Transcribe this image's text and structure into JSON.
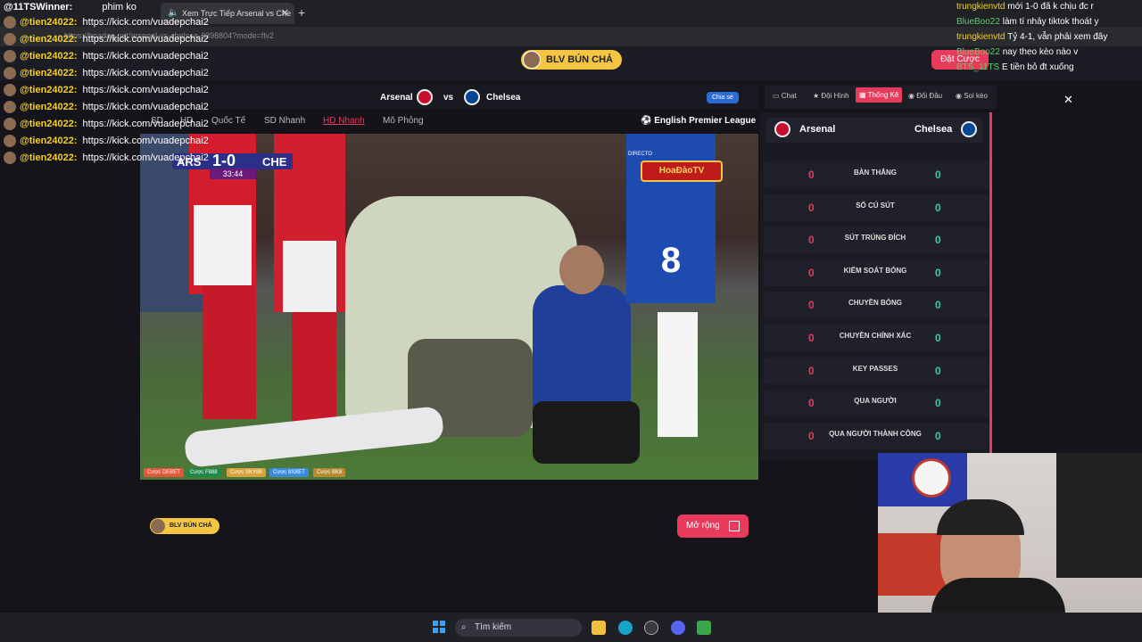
{
  "browser": {
    "tab_title": "Xem Trực Tiếp Arsenal vs Che",
    "url": "https://hoadao.net/arsenal-vs-chelsea-2398804?mode=flv2",
    "overlay_user": "@11TSWinner:",
    "overlay_msg": "phim ko"
  },
  "header": {
    "commentator": "BLV BÚN CHẢ",
    "bet_button": "Đặt Cược"
  },
  "match": {
    "home": "Arsenal",
    "vs": "vs",
    "away": "Chelsea",
    "share": "Chia sẻ",
    "quality_tabs": [
      "SD",
      "HD",
      "Quốc Tế",
      "SD Nhanh",
      "HD Nhanh",
      "Mô Phỏng"
    ],
    "league": "English Premier League"
  },
  "scoreboard": {
    "home_code": "ARS",
    "score": "1-0",
    "away_code": "CHE",
    "clock": "33:44",
    "broadcaster": "HoaĐàoTV",
    "directo": "DIRECTO"
  },
  "bet_chips": [
    "Cược DEBET",
    "Cược F888",
    "Cược SKY88",
    "Cược 8XBET",
    "Cược BK8"
  ],
  "chat_overlay": [
    {
      "user": "@tien24022:",
      "msg": "https://kick.com/vuadepchai2"
    },
    {
      "user": "@tien24022:",
      "msg": "https://kick.com/vuadepchai2"
    },
    {
      "user": "@tien24022:",
      "msg": "https://kick.com/vuadepchai2"
    },
    {
      "user": "@tien24022:",
      "msg": "https://kick.com/vuadepchai2"
    },
    {
      "user": "@tien24022:",
      "msg": "https://kick.com/vuadepchai2"
    },
    {
      "user": "@tien24022:",
      "msg": "https://kick.com/vuadepchai2"
    },
    {
      "user": "@tien24022:",
      "msg": "https://kick.com/vuadepchai2"
    },
    {
      "user": "@tien24022:",
      "msg": "https://kick.com/vuadepchai2"
    },
    {
      "user": "@tien24022:",
      "msg": "https://kick.com/vuadepchai2"
    }
  ],
  "right_chat": [
    {
      "user": "trungkienvtd",
      "msg": "mới 1-0 đã k chịu đc r",
      "cls": "u1"
    },
    {
      "user": "BlueBoo22",
      "msg": "làm tí nhảy tiktok thoát y",
      "cls": "u2"
    },
    {
      "user": "trungkienvtd",
      "msg": "Tỷ 4-1, vẫn phải xem đây",
      "cls": "u1"
    },
    {
      "user": "BlueBoo22",
      "msg": "nay theo kèo nào v",
      "cls": "u2"
    },
    {
      "user": "BTS_11TS",
      "msg": "E tiền bỏ đt xuống",
      "cls": "u2"
    }
  ],
  "panel": {
    "tabs": [
      "Chat",
      "Đội Hình",
      "Thống Kê",
      "Đối Đầu",
      "Soi kèo"
    ],
    "home": "Arsenal",
    "away": "Chelsea",
    "stats": [
      {
        "label": "BÀN THẮNG",
        "home": 0,
        "away": 0
      },
      {
        "label": "SỐ CÚ SÚT",
        "home": 0,
        "away": 0
      },
      {
        "label": "SÚT TRÚNG ĐÍCH",
        "home": 0,
        "away": 0
      },
      {
        "label": "KIỂM SOÁT BÓNG",
        "home": 0,
        "away": 0
      },
      {
        "label": "CHUYỀN BÓNG",
        "home": 0,
        "away": 0
      },
      {
        "label": "CHUYỀN CHÍNH XÁC",
        "home": 0,
        "away": 0
      },
      {
        "label": "KEY PASSES",
        "home": 0,
        "away": 0
      },
      {
        "label": "QUA NGƯỜI",
        "home": 0,
        "away": 0
      },
      {
        "label": "QUA NGƯỜI THÀNH CÔNG",
        "home": 0,
        "away": 0
      }
    ]
  },
  "footer": {
    "commentator": "BLV BÚN CHẢ",
    "expand": "Mở rộng"
  },
  "taskbar": {
    "search": "Tìm kiếm"
  },
  "colors": {
    "accent": "#e83a5a",
    "stat_away": "#2fd1a6",
    "chat_user": "#f5d020"
  }
}
